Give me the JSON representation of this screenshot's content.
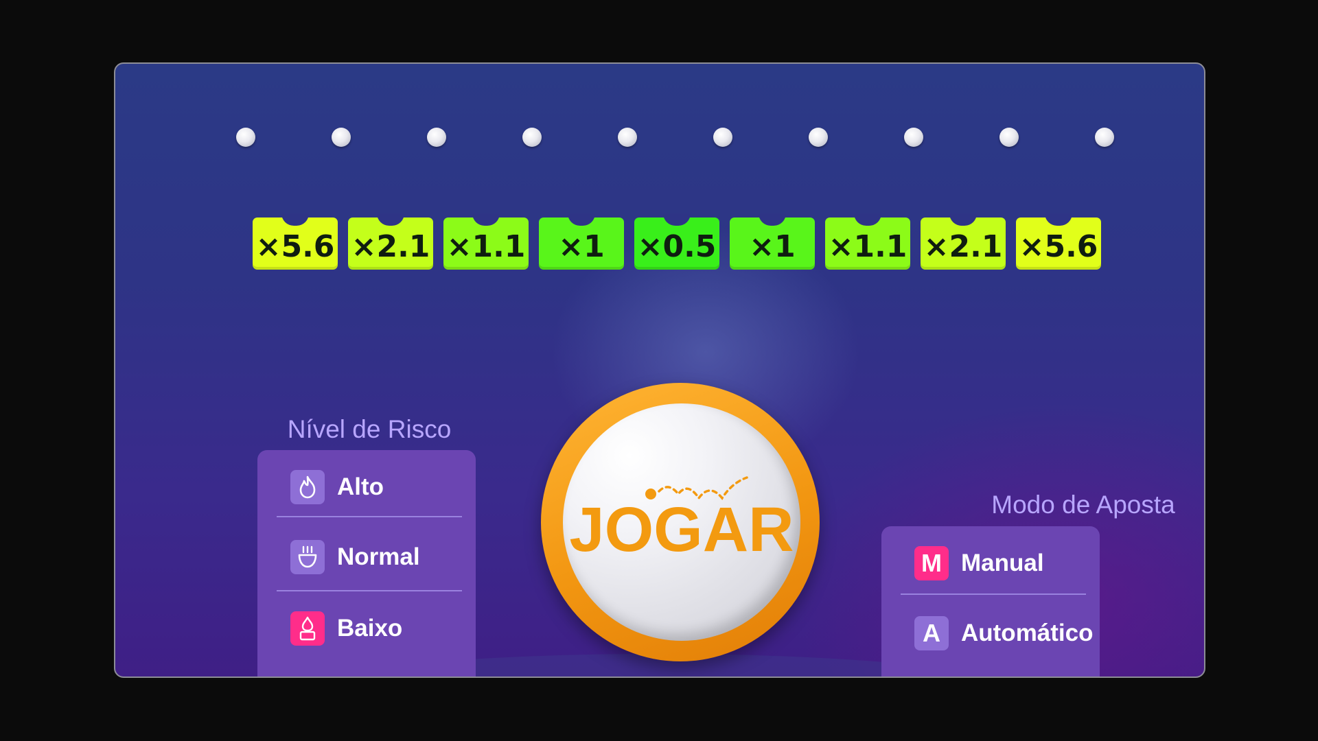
{
  "pins": {
    "count": 10
  },
  "multipliers": [
    {
      "label": "×5.6",
      "color": "#e1ff1a"
    },
    {
      "label": "×2.1",
      "color": "#c4ff1a"
    },
    {
      "label": "×1.1",
      "color": "#8cfb18"
    },
    {
      "label": "×1",
      "color": "#59f51a"
    },
    {
      "label": "×0.5",
      "color": "#39ef1a"
    },
    {
      "label": "×1",
      "color": "#59f51a"
    },
    {
      "label": "×1.1",
      "color": "#8cfb18"
    },
    {
      "label": "×2.1",
      "color": "#c4ff1a"
    },
    {
      "label": "×5.6",
      "color": "#e1ff1a"
    }
  ],
  "risk": {
    "title": "Nível de Risco",
    "options": [
      {
        "label": "Alto",
        "icon": "flame-icon",
        "active": false
      },
      {
        "label": "Normal",
        "icon": "steaming-cup-icon",
        "active": false
      },
      {
        "label": "Baixo",
        "icon": "low-flame-icon",
        "active": true
      }
    ]
  },
  "play": {
    "label": "JOGAR"
  },
  "mode": {
    "title": "Modo de Aposta",
    "options": [
      {
        "label": "Manual",
        "icon_letter": "M",
        "active": true
      },
      {
        "label": "Automático",
        "icon_letter": "A",
        "active": false
      }
    ]
  },
  "colors": {
    "accent_orange": "#f39a10",
    "active_pink": "#ff2d8a",
    "panel_purple": "#6b45b2"
  }
}
